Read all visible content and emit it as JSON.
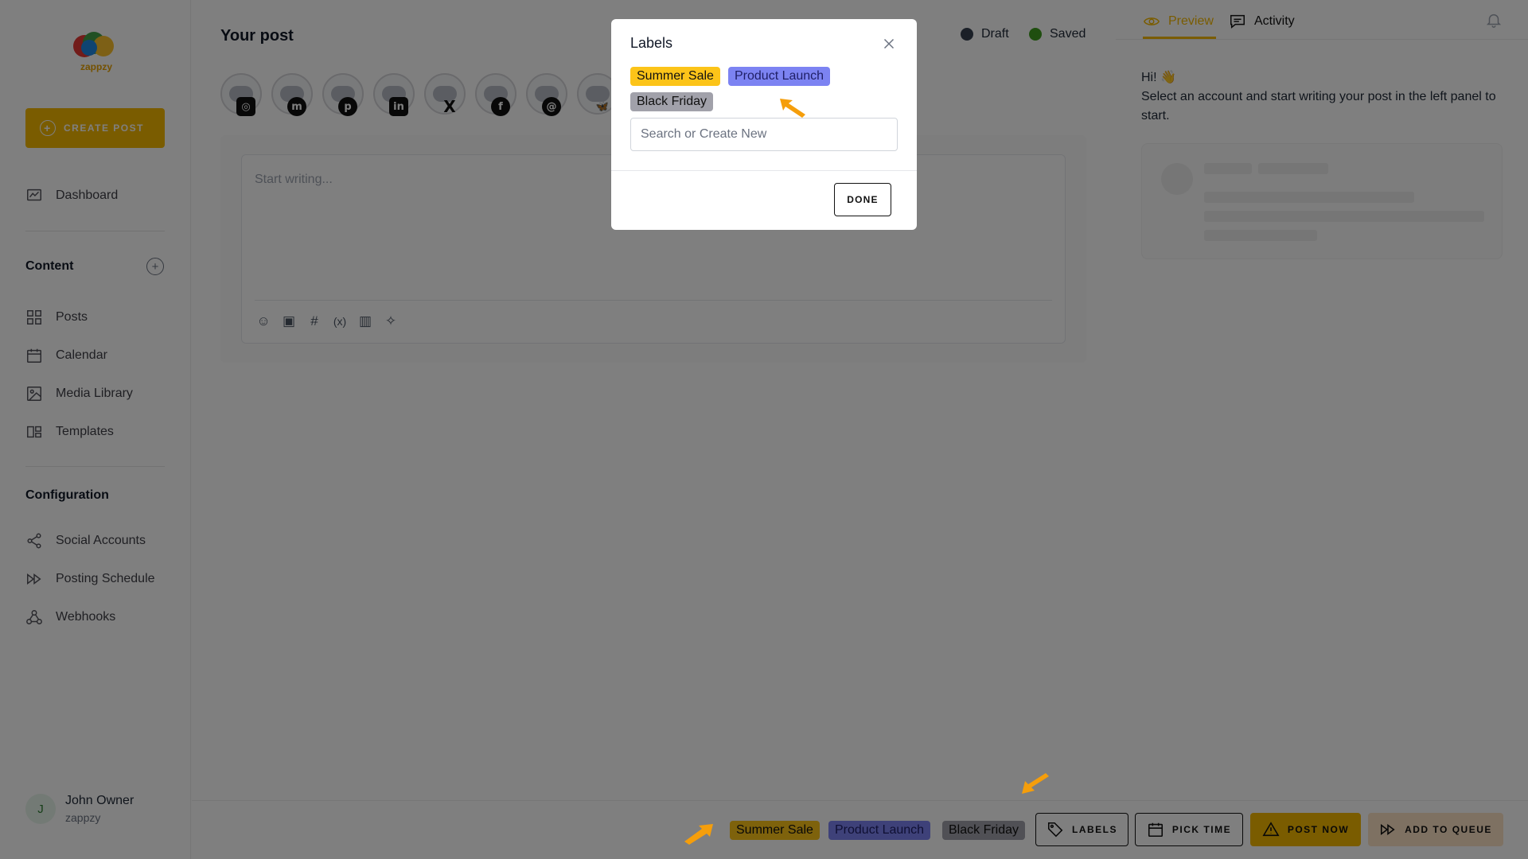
{
  "app": {
    "brand": "zappzy"
  },
  "sidebar": {
    "create_label": "CREATE POST",
    "dashboard": "Dashboard",
    "content_title": "Content",
    "content_items": [
      "Posts",
      "Calendar",
      "Media Library",
      "Templates"
    ],
    "config_title": "Configuration",
    "config_items": [
      "Social Accounts",
      "Posting Schedule",
      "Webhooks"
    ],
    "user": {
      "initial": "J",
      "name": "John Owner",
      "org": "zappzy"
    }
  },
  "main": {
    "title": "Your post",
    "status_draft": "Draft",
    "status_saved": "Saved",
    "editor_placeholder": "Start writing...",
    "accounts": [
      {
        "network": "instagram-icon",
        "glyph": "◎"
      },
      {
        "network": "mastodon-icon",
        "glyph": "m"
      },
      {
        "network": "pinterest-icon",
        "glyph": "p"
      },
      {
        "network": "linkedin-icon",
        "glyph": "in"
      },
      {
        "network": "x-icon",
        "glyph": "X"
      },
      {
        "network": "facebook-icon",
        "glyph": "f"
      },
      {
        "network": "threads-icon",
        "glyph": "@"
      },
      {
        "network": "bluesky-icon",
        "glyph": "🦋"
      }
    ]
  },
  "bottom_bar": {
    "labels": [
      "Summer Sale",
      "Product Launch",
      "Black Friday"
    ],
    "labels_btn": "LABELS",
    "pick_time_btn": "PICK TIME",
    "post_now_btn": "POST NOW",
    "add_queue_btn": "ADD TO QUEUE"
  },
  "preview": {
    "tab_preview": "Preview",
    "tab_activity": "Activity",
    "greeting": "Hi! 👋",
    "message": "Select an account and start writing your post in the left panel to start."
  },
  "modal": {
    "title": "Labels",
    "labels": [
      "Summer Sale",
      "Product Launch",
      "Black Friday"
    ],
    "search_placeholder": "Search or Create New",
    "done": "DONE"
  },
  "colors": {
    "accent": "#f5b800",
    "label_summer": "#fcc419",
    "label_product": "#7c83f2",
    "label_black": "#a1a1aa",
    "status_draft": "#374151",
    "status_saved": "#3f9d1f",
    "arrow": "#f59e0b"
  }
}
